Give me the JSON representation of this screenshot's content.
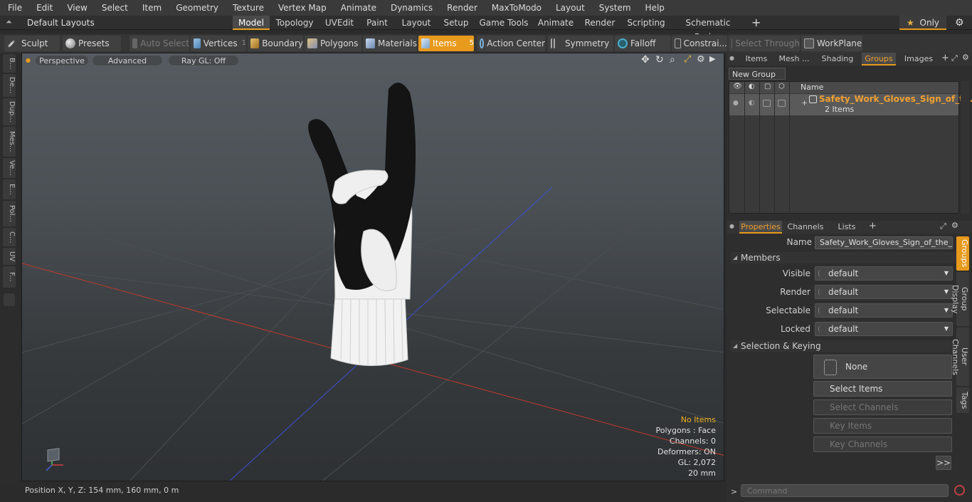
{
  "menu": [
    "File",
    "Edit",
    "View",
    "Select",
    "Item",
    "Geometry",
    "Texture",
    "Vertex Map",
    "Animate",
    "Dynamics",
    "Render",
    "MaxToModo",
    "Layout",
    "System",
    "Help"
  ],
  "layout_selector": "Default Layouts",
  "layout_tabs": [
    "Model",
    "Topology",
    "UVEdit",
    "Paint",
    "Layout",
    "Setup",
    "Game Tools",
    "Animate",
    "Render",
    "Scripting",
    "Schematic Fusion"
  ],
  "only_label": "Only",
  "toolbar": {
    "sculpt": "Sculpt",
    "presets": "Presets",
    "auto_select": "Auto Select",
    "vertices": "Vertices",
    "vertices_count": "1",
    "boundary": "Boundary",
    "polygons": "Polygons",
    "materials": "Materials",
    "items": "Items",
    "items_count": "5",
    "action_center": "Action Center",
    "symmetry": "Symmetry",
    "falloff": "Falloff",
    "constraints": "Constrai...",
    "select_through": "Select Through",
    "workplane": "WorkPlane"
  },
  "left_tabs": [
    "B...",
    "De...",
    "Dup...",
    "Mes...",
    "Ve...",
    "E...",
    "Pol...",
    "C...",
    "UV",
    "F..."
  ],
  "viewport": {
    "perspective": "Perspective",
    "advanced": "Advanced",
    "raygl": "Ray GL: Off",
    "overlay": {
      "no_items": "No Items",
      "polygons": "Polygons : Face",
      "channels": "Channels: 0",
      "deformers": "Deformers: ON",
      "gl": "GL: 2,072",
      "size": "20 mm"
    }
  },
  "status": {
    "position": "Position X, Y, Z:   154 mm, 160 mm, 0 m"
  },
  "groups_panel": {
    "tabs": [
      "Items",
      "Mesh ...",
      "Shading",
      "Groups",
      "Images"
    ],
    "active_tab": "Groups",
    "new_group": "New Group",
    "name_header": "Name",
    "group_name": "Safety_Work_Gloves_Sign_of_t ...",
    "group_count": "2 Items"
  },
  "properties_panel": {
    "tabs": [
      "Properties",
      "Channels",
      "Lists"
    ],
    "name_label": "Name",
    "name_value": "Safety_Work_Gloves_Sign_of_the_Ho",
    "members": "Members",
    "visible_label": "Visible",
    "visible_value": "default",
    "render_label": "Render",
    "render_value": "default",
    "selectable_label": "Selectable",
    "selectable_value": "default",
    "locked_label": "Locked",
    "locked_value": "default",
    "selection_keying": "Selection & Keying",
    "none_btn": "None",
    "select_items": "Select Items",
    "select_channels": "Select Channels",
    "key_items": "Key Items",
    "key_channels": "Key Channels",
    "more": ">>",
    "side_tabs": [
      "Groups",
      "Group Display",
      "User Channels",
      "Tags"
    ]
  },
  "command": {
    "prompt": ">",
    "placeholder": "Command"
  },
  "colors": {
    "accent": "#e89a1c",
    "x_axis": "#c0392b",
    "z_axis": "#3c4fd0"
  }
}
